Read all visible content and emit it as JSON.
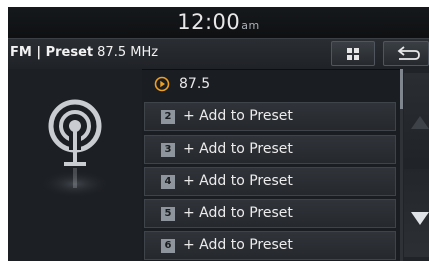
{
  "clock": {
    "time": "12:00",
    "ampm": "am"
  },
  "header": {
    "source": "FM | Preset",
    "frequency": "87.5 MHz"
  },
  "buttons": {
    "menu_icon": "grid-menu-icon",
    "back_icon": "return-arrow-icon"
  },
  "current": {
    "icon": "play-circle-icon",
    "frequency": "87.5"
  },
  "presets": [
    {
      "number": "2",
      "label": "+ Add to Preset"
    },
    {
      "number": "3",
      "label": "+ Add to Preset"
    },
    {
      "number": "4",
      "label": "+ Add to Preset"
    },
    {
      "number": "5",
      "label": "+ Add to Preset"
    },
    {
      "number": "6",
      "label": "+ Add to Preset"
    }
  ],
  "colors": {
    "accent": "#f0a020",
    "background": "#1a1d21",
    "row": "#2b2f34"
  }
}
